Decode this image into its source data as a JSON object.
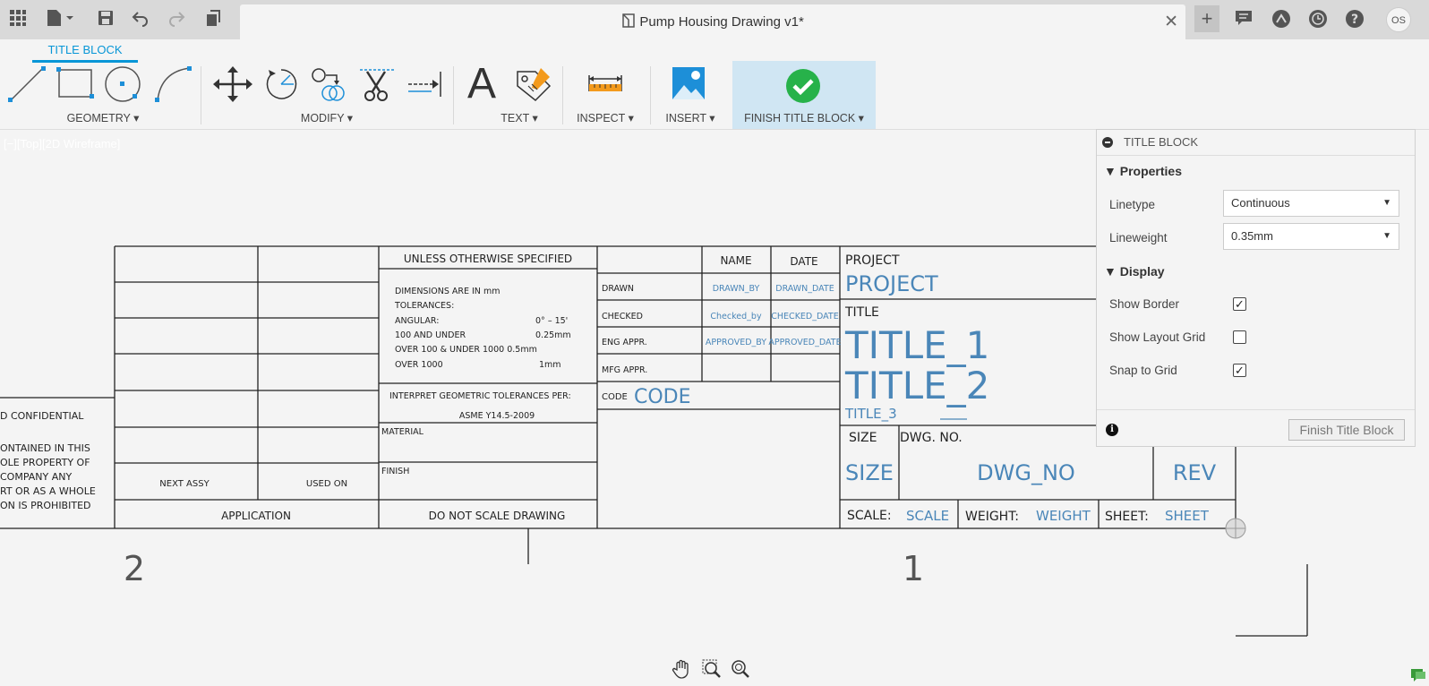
{
  "document": {
    "title": "Pump Housing Drawing v1*"
  },
  "ribbon": {
    "active_tab": "TITLE BLOCK",
    "groups": {
      "geometry": "GEOMETRY ▾",
      "modify": "MODIFY ▾",
      "text": "TEXT ▾",
      "inspect": "INSPECT ▾",
      "insert": "INSERT ▾",
      "finish": "FINISH TITLE BLOCK ▾"
    }
  },
  "viewport": {
    "label": "[−][Top][2D Wireframe]"
  },
  "user": {
    "initials": "OS"
  },
  "title_block": {
    "tolerance_header": "UNLESS OTHERWISE SPECIFIED",
    "tol_lines": [
      "DIMENSIONS ARE IN mm",
      "TOLERANCES:",
      "ANGULAR:",
      "100 AND UNDER",
      "OVER 100 & UNDER 1000  0.5mm",
      "OVER 1000"
    ],
    "tol_values": [
      "0° – 15'",
      "0.25mm",
      "1mm"
    ],
    "gdt_line1": "INTERPRET GEOMETRIC TOLERANCES PER:",
    "gdt_line2": "ASME Y14.5-2009",
    "material": "MATERIAL",
    "finish": "FINISH",
    "no_scale": "DO NOT SCALE DRAWING",
    "next_assy": "NEXT ASSY",
    "used_on": "USED ON",
    "application": "APPLICATION",
    "confidential": [
      "D CONFIDENTIAL",
      "ONTAINED IN THIS",
      "OLE PROPERTY OF",
      "COMPANY ANY",
      "RT OR AS A WHOLE",
      "ON IS PROHIBITED"
    ],
    "name_hdr": "NAME",
    "date_hdr": "DATE",
    "rows": [
      {
        "label": "DRAWN",
        "name": "DRAWN_BY",
        "date": "DRAWN_DATE"
      },
      {
        "label": "CHECKED",
        "name": "Checked_by",
        "date": "CHECKED_DATE"
      },
      {
        "label": "ENG APPR.",
        "name": "APPROVED_BY",
        "date": "APPROVED_DATE"
      },
      {
        "label": "MFG APPR.",
        "name": "",
        "date": ""
      }
    ],
    "code_label": "CODE",
    "code_value": "CODE",
    "project_label": "PROJECT",
    "project_value": "PROJECT",
    "title_label": "TITLE",
    "title1": "TITLE_1",
    "title2": "TITLE_2",
    "title3": "TITLE_3",
    "size_label": "SIZE",
    "size_value": "SIZE",
    "dwg_label": "DWG.  NO.",
    "dwg_value": "DWG_NO",
    "rev_value": "REV",
    "scale_label": "SCALE:",
    "scale_value": "SCALE",
    "weight_label": "WEIGHT:",
    "weight_value": "WEIGHT",
    "sheet_label": "SHEET:",
    "sheet_value": "SHEET",
    "zone_left": "2",
    "zone_right": "1"
  },
  "panel": {
    "title": "TITLE BLOCK",
    "properties": "▼ Properties",
    "linetype_label": "Linetype",
    "linetype_value": "Continuous",
    "lineweight_label": "Lineweight",
    "lineweight_value": "0.35mm",
    "display": "▼ Display",
    "show_border": "Show Border",
    "show_layout_grid": "Show Layout Grid",
    "snap_to_grid": "Snap to Grid",
    "show_border_checked": true,
    "show_layout_grid_checked": false,
    "snap_to_grid_checked": true,
    "finish_button": "Finish Title Block"
  },
  "colors": {
    "accent": "#0696d7",
    "field_blue": "#4a86b8",
    "finish_bg": "#d0e6f3",
    "check_green": "#27b24a"
  }
}
